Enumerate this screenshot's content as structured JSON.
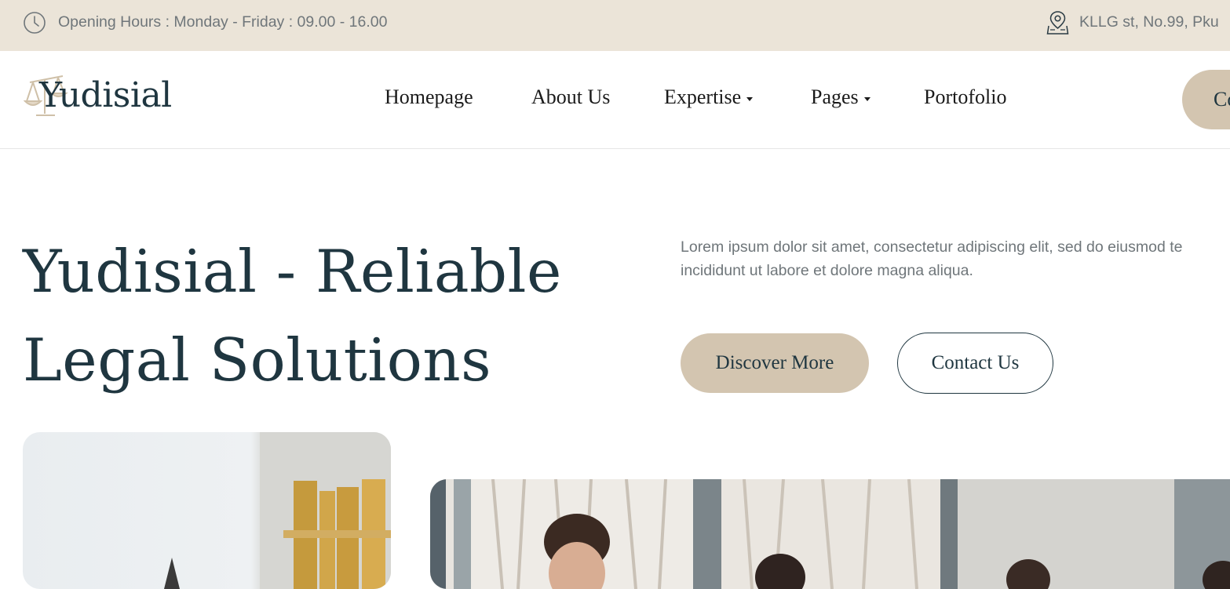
{
  "topbar": {
    "hours_icon": "clock-icon",
    "hours_text": "Opening Hours : Monday - Friday : 09.00 - 16.00",
    "address_icon": "map-pin-icon",
    "address_text": "KLLG st, No.99, Pku"
  },
  "header": {
    "logo_icon": "scales-of-justice-icon",
    "logo_text": "Yudisial",
    "nav": {
      "homepage": "Homepage",
      "about": "About Us",
      "expertise": "Expertise",
      "pages": "Pages",
      "portfolio": "Portofolio"
    },
    "cta_label": "Co"
  },
  "hero": {
    "title_line1": "Yudisial - Reliable",
    "title_line2": "Legal Solutions",
    "description": "Lorem ipsum dolor sit amet, consectetur adipiscing elit, sed do eiusmod te incididunt ut labore et dolore magna aliqua.",
    "primary_button": "Discover More",
    "secondary_button": "Contact Us"
  },
  "colors": {
    "topbar_bg": "#ebe4d8",
    "accent": "#d3c5b0",
    "heading": "#1f3640",
    "body_text": "#6f767a"
  }
}
